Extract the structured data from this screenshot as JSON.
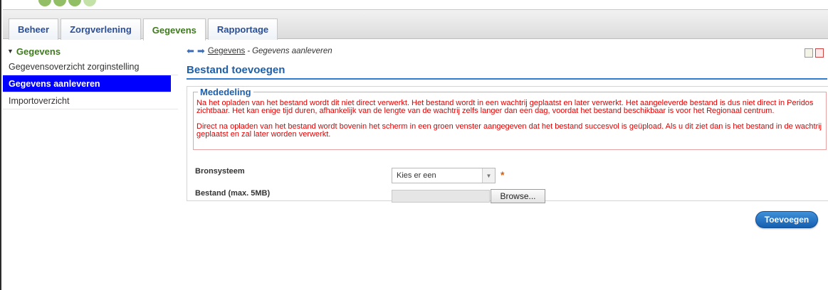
{
  "tabs": [
    {
      "label": "Beheer",
      "active": false
    },
    {
      "label": "Zorgverlening",
      "active": false
    },
    {
      "label": "Gegevens",
      "active": true
    },
    {
      "label": "Rapportage",
      "active": false
    }
  ],
  "sidebar": {
    "section": "Gegevens",
    "items": [
      {
        "label": "Gegevensoverzicht zorginstelling",
        "active": false
      },
      {
        "label": "Gegevens aanleveren",
        "active": true
      },
      {
        "label": "Importoverzicht",
        "active": false
      }
    ]
  },
  "breadcrumb": {
    "link": "Gegevens",
    "separator": "-",
    "current": "Gegevens aanleveren"
  },
  "page": {
    "title": "Bestand toevoegen"
  },
  "notice": {
    "legend": "Mededeling",
    "paragraph1": "Na het opladen van het bestand wordt dit niet direct verwerkt. Het bestand wordt in een wachtrij geplaatst en later verwerkt. Het aangeleverde bestand is dus niet direct in Peridos zichtbaar. Het kan enige tijd duren, afhankelijk van de lengte van de wachtrij zelfs langer dan een dag, voordat het bestand beschikbaar is voor het Regionaal centrum.",
    "paragraph2": "Direct na opladen van het bestand wordt bovenin het scherm in een groen venster aangegeven dat het bestand succesvol is geüpload. Als u dit ziet dan is het bestand in de wachtrij geplaatst en zal later worden verwerkt."
  },
  "form": {
    "bronsysteem_label": "Bronsysteem",
    "bronsysteem_value": "Kies er een",
    "required_marker": "*",
    "bestand_label": "Bestand (max. 5MB)",
    "browse_label": "Browse...",
    "submit_label": "Toevoegen"
  },
  "colors": {
    "accent_blue": "#1f5fa8",
    "active_green": "#3f7a1e",
    "selected_bg": "#0000ff",
    "notice_red": "#e00000"
  }
}
